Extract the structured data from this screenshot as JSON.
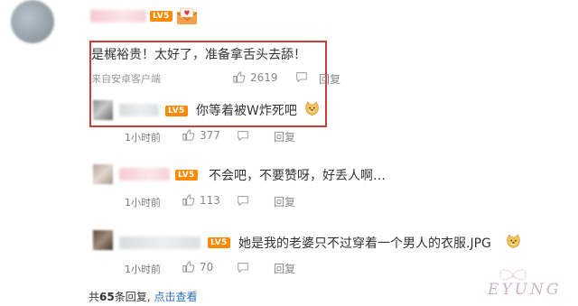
{
  "main_comment": {
    "text": "是梶裕贵！太好了，准备拿舌头去舔！",
    "source": "来自安卓客户端",
    "like_count": "2619",
    "reply_label": "回复",
    "badge": "LV5"
  },
  "replies": [
    {
      "text": "你等着被W炸死吧",
      "time": "1小时前",
      "like_count": "377",
      "reply_label": "回复",
      "badge": "LV5"
    },
    {
      "text": "不会吧，不要赞呀，好丢人啊…",
      "time": "1小时前",
      "like_count": "113",
      "reply_label": "回复",
      "badge": "LV5"
    },
    {
      "text": "她是我的老婆只不过穿着一个男人的衣服.JPG",
      "time": "1小时前",
      "like_count": "70",
      "reply_label": "回复",
      "badge": "LV5"
    }
  ],
  "footer": {
    "total_prefix": "共",
    "total_count": "65",
    "total_suffix": "条回复,",
    "view_link": "点击查看"
  },
  "watermark": {
    "text": "EYUNG"
  },
  "colors": {
    "highlight": "#c93d3d",
    "badge": "#ff8a00",
    "link": "#2a6fb8",
    "meta": "#999999"
  },
  "icons": [
    "thumbs-up-icon",
    "comment-icon",
    "envelope-heart-icon",
    "doge-emoji-icon"
  ]
}
